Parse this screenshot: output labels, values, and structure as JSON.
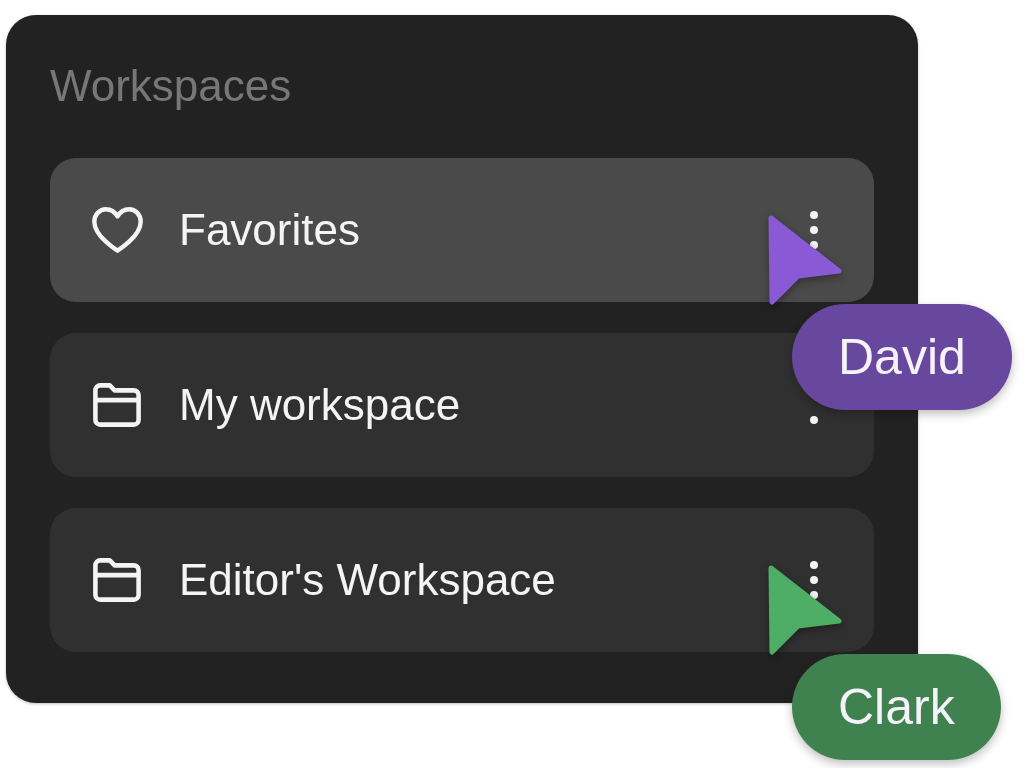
{
  "panel": {
    "title": "Workspaces"
  },
  "workspaces": [
    {
      "label": "Favorites",
      "kind": "favorites",
      "selected": true,
      "cursor": {
        "name": "David",
        "color": "#8a5ad6"
      }
    },
    {
      "label": "My workspace",
      "kind": "folder",
      "selected": false
    },
    {
      "label": "Editor's Workspace",
      "kind": "folder",
      "selected": false,
      "cursor": {
        "name": "Clark",
        "color": "#4fae65"
      }
    }
  ]
}
